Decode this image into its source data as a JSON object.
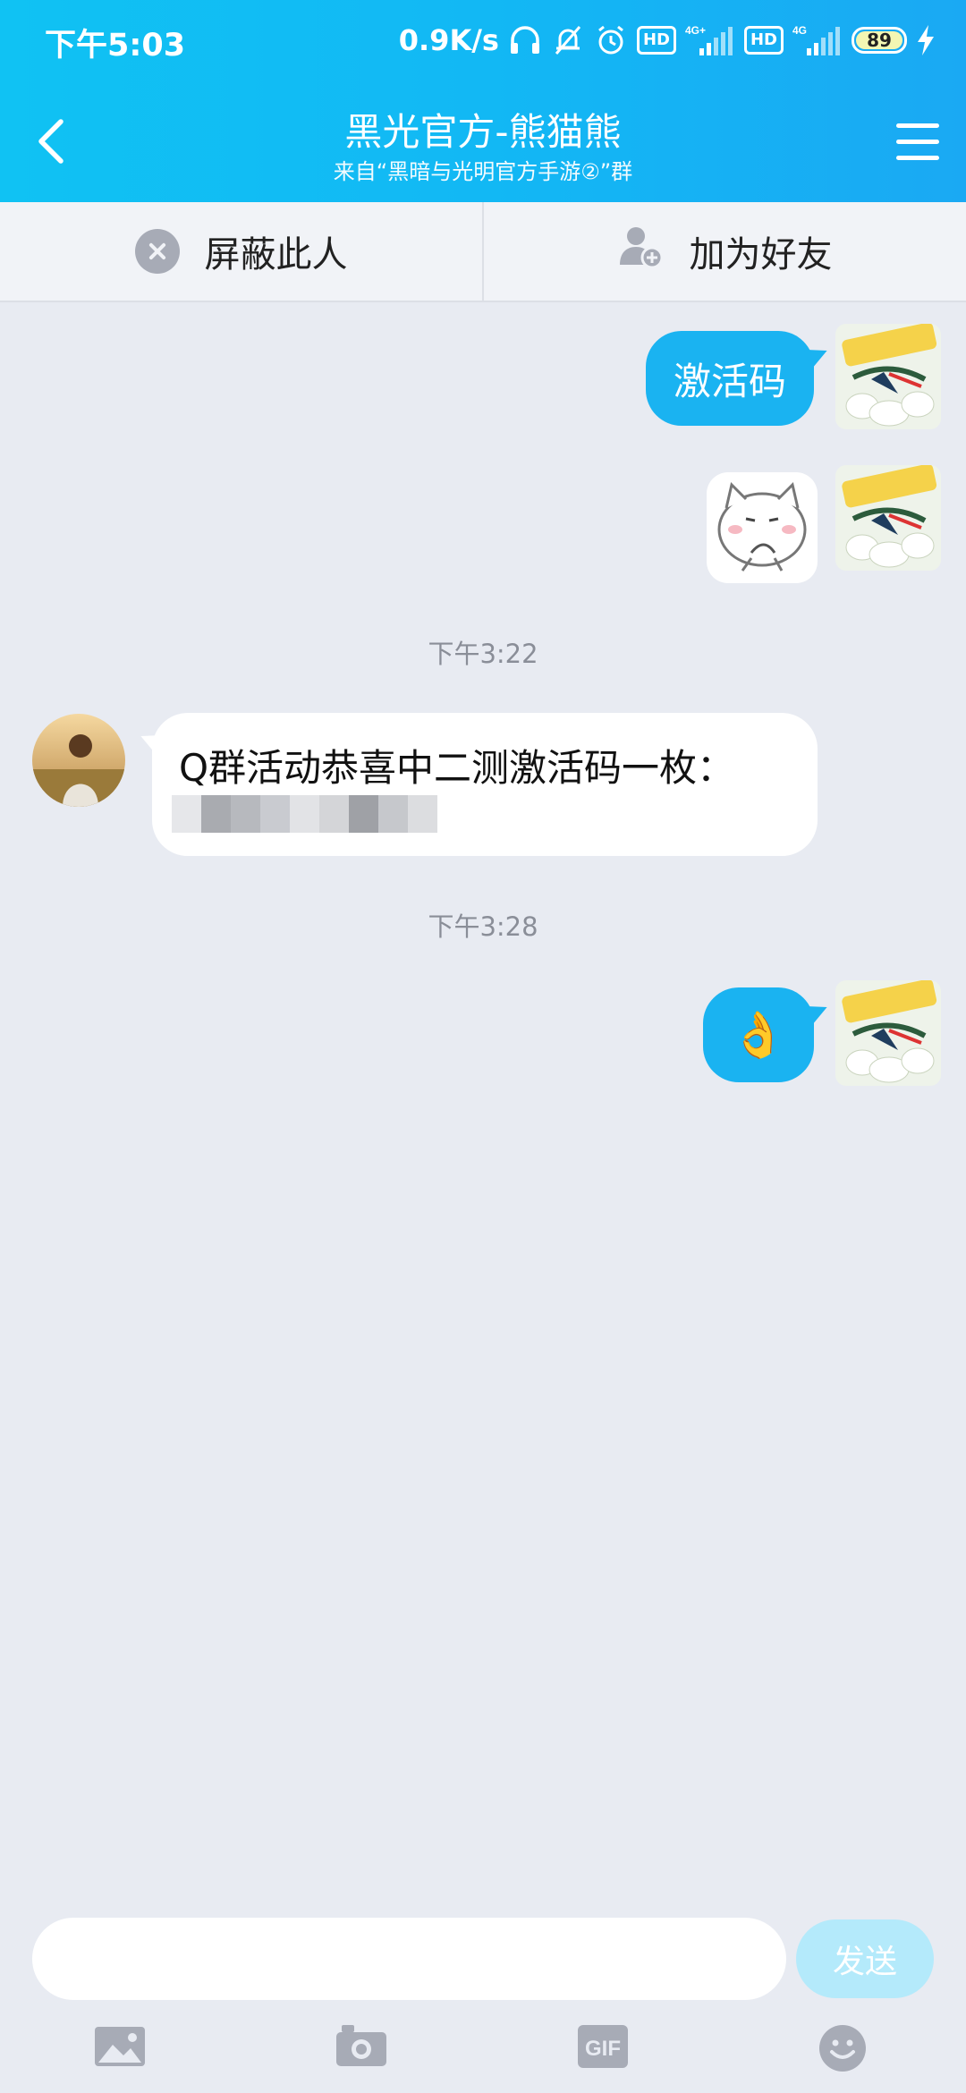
{
  "status_bar": {
    "time": "下午5:03",
    "speed": "0.9K/s",
    "hd1": "HD",
    "net1": "4G+",
    "hd2": "HD",
    "net2": "4G",
    "battery": "89"
  },
  "header": {
    "title": "黑光官方-熊猫熊",
    "subtitle": "来自“黑暗与光明官方手游②”群"
  },
  "actions": {
    "block_label": "屏蔽此人",
    "add_friend_label": "加为好友"
  },
  "messages": {
    "msg1_text": "激活码",
    "time1": "下午3:22",
    "incoming_text": "Q群活动恭喜中二测激活码一枚：",
    "time2": "下午3:28",
    "emoji": "👌"
  },
  "composer": {
    "send_label": "发送",
    "gif_label": "GIF"
  },
  "colors": {
    "accent": "#12b8f4",
    "outgoing_bubble": "#1ab3f1",
    "background": "#e8ebf2"
  }
}
